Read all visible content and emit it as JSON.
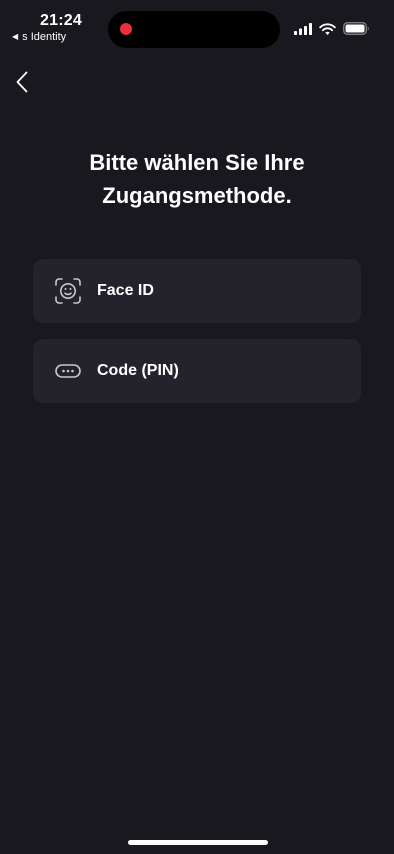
{
  "status_bar": {
    "time": "21:24",
    "back_app_label": "s Identity",
    "back_app_glyph": "◀",
    "icons": [
      "signal-icon",
      "wifi-icon",
      "battery-icon"
    ]
  },
  "nav": {
    "back_icon": "chevron-left-icon"
  },
  "title": {
    "line1": "Bitte wählen Sie Ihre",
    "line2": "Zugangsmethode."
  },
  "options": [
    {
      "label": "Face ID",
      "icon": "face-id-icon"
    },
    {
      "label": "Code (PIN)",
      "icon": "pin-code-icon"
    }
  ],
  "colors": {
    "background": "#19181e",
    "card": "#24232b",
    "text": "#ffffff",
    "icon": "#c8c8cf",
    "recording_dot": "#e8313a"
  }
}
